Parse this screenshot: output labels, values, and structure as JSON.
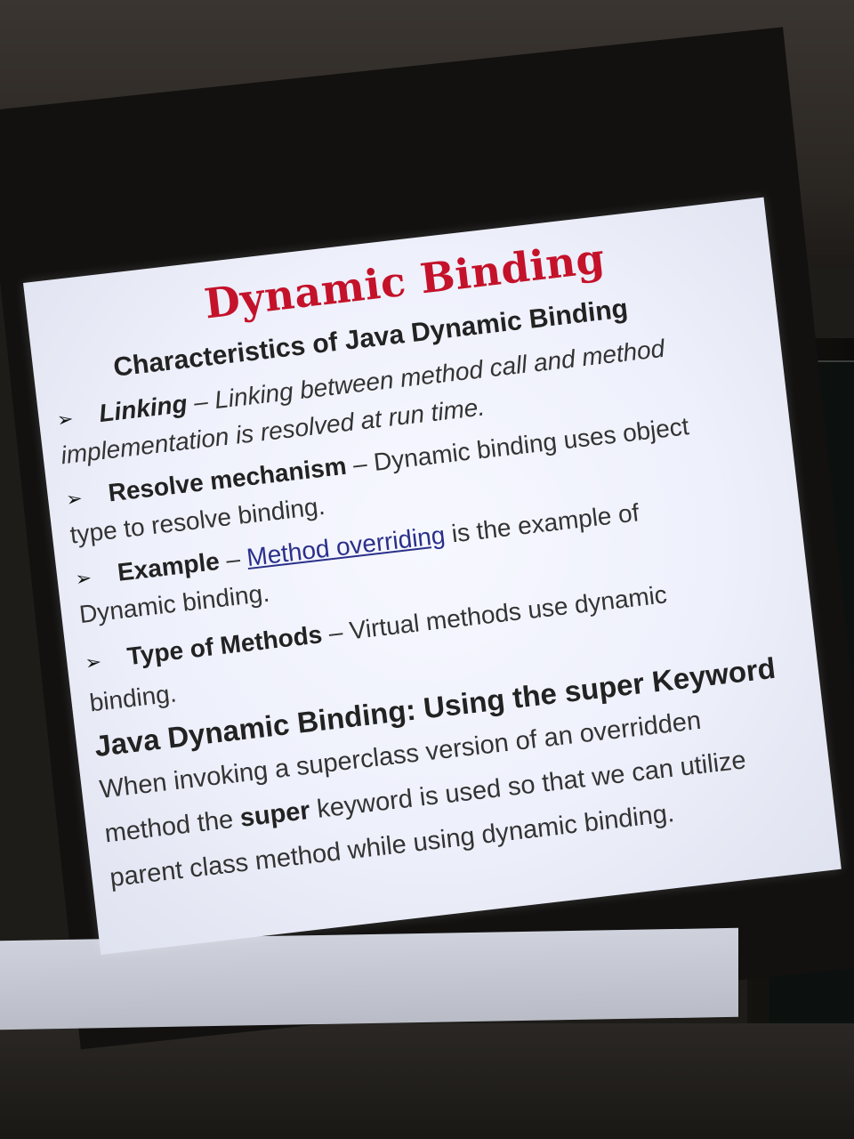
{
  "slide": {
    "title": "Dynamic Binding",
    "subheading": "Characteristics of Java Dynamic Binding",
    "bullets": [
      {
        "label": "Linking",
        "dash": " – ",
        "text1": "Linking between method call and method",
        "text2": "implementation is resolved at run time."
      },
      {
        "label": "Resolve mechanism",
        "dash": " – ",
        "text1": "Dynamic binding uses object",
        "text2": "type to resolve binding."
      },
      {
        "label": "Example",
        "dash": " – ",
        "link": "Method overriding",
        "text1": " is the example of",
        "text2": "Dynamic binding."
      },
      {
        "label": "Type of Methods",
        "dash": " – ",
        "text1": "Virtual methods use dynamic",
        "text2": "binding."
      }
    ],
    "section_heading": "Java Dynamic Binding: Using the super Keyword",
    "paragraph": {
      "line1": "When invoking a superclass version of an overridden",
      "line2_before": "method the ",
      "line2_bold": "super",
      "line2_after": " keyword is used so that we can utilize",
      "line3": "parent class method while using dynamic binding."
    },
    "bullet_glyph": "➢"
  }
}
